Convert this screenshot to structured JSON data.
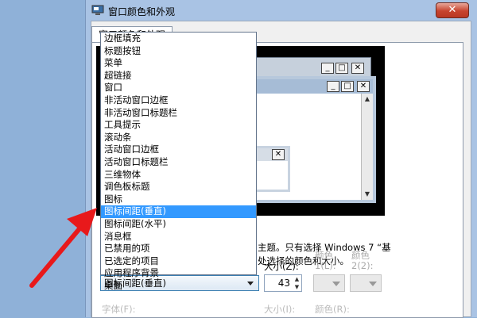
{
  "window": {
    "title": "窗口颜色和外观",
    "close_glyph": "✕"
  },
  "tab": {
    "label": "窗口颜色和外观"
  },
  "preview": {
    "control_glyphs": {
      "minimize": "_",
      "maximize": "□",
      "close": "✕"
    }
  },
  "description": {
    "line1": "主题。只有选择 Windows 7 “基",
    "line2": "处选择的颜色和大小。"
  },
  "item_dropdown": {
    "options": [
      "边框填充",
      "标题按钮",
      "菜单",
      "超链接",
      "窗口",
      "非活动窗口边框",
      "非活动窗口标题栏",
      "工具提示",
      "滚动条",
      "活动窗口边框",
      "活动窗口标题栏",
      "三维物体",
      "调色板标题",
      "图标",
      "图标间距(垂直)",
      "图标间距(水平)",
      "消息框",
      "已禁用的项",
      "已选定的项目",
      "应用程序背景",
      "桌面"
    ],
    "selected_index": 14,
    "selected_value": "图标间距(垂直)"
  },
  "size": {
    "label": "大小(Z):",
    "value": "43"
  },
  "color1": {
    "label_line1": "颜色",
    "label_line2": "1(L):"
  },
  "color2": {
    "label_line1": "颜色",
    "label_line2": "2(2):"
  },
  "font": {
    "label": "字体(F):"
  },
  "font_size": {
    "label": "大小(I):"
  },
  "font_color": {
    "label": "颜色(R):"
  },
  "colors": {
    "accent": "#3399ff",
    "arrow": "#e8191b"
  }
}
